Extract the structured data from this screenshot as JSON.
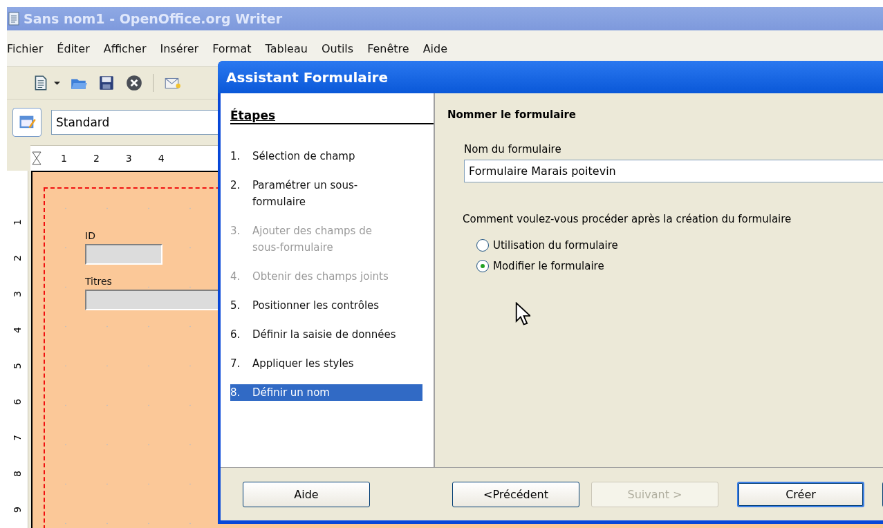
{
  "window": {
    "title": "Sans nom1 - OpenOffice.org Writer"
  },
  "menu": [
    "Fichier",
    "Éditer",
    "Afficher",
    "Insérer",
    "Format",
    "Tableau",
    "Outils",
    "Fenêtre",
    "Aide"
  ],
  "format_bar": {
    "paragraph_style": "Standard"
  },
  "ruler": {
    "horizontal": [
      "1",
      "2",
      "3",
      "4"
    ],
    "vertical": [
      "1",
      "2",
      "3",
      "4",
      "5",
      "6",
      "7",
      "8",
      "9"
    ]
  },
  "document": {
    "controls": [
      {
        "label": "ID",
        "kind": "short"
      },
      {
        "label": "Titres",
        "kind": "wide"
      }
    ]
  },
  "dialog": {
    "title": "Assistant Formulaire",
    "steps_heading": "Étapes",
    "steps": [
      {
        "number": "1.",
        "label": "Sélection de champ",
        "disabled": false,
        "selected": false
      },
      {
        "number": "2.",
        "label": "Paramétrer un sous-formulaire",
        "disabled": false,
        "selected": false
      },
      {
        "number": "3.",
        "label": "Ajouter des champs de sous-formulaire",
        "disabled": true,
        "selected": false
      },
      {
        "number": "4.",
        "label": "Obtenir des champs joints",
        "disabled": true,
        "selected": false
      },
      {
        "number": "5.",
        "label": "Positionner les contrôles",
        "disabled": false,
        "selected": false
      },
      {
        "number": "6.",
        "label": "Définir la saisie de données",
        "disabled": false,
        "selected": false
      },
      {
        "number": "7.",
        "label": "Appliquer les styles",
        "disabled": false,
        "selected": false
      },
      {
        "number": "8.",
        "label": "Définir un nom",
        "disabled": false,
        "selected": true
      }
    ],
    "section_title": "Nommer le formulaire",
    "name_label": "Nom du formulaire",
    "name_value": "Formulaire Marais poitevin",
    "question": "Comment voulez-vous procéder après la création du formulaire",
    "options": [
      {
        "label": "Utilisation du formulaire",
        "selected": false
      },
      {
        "label": "Modifier le formulaire",
        "selected": true
      }
    ],
    "buttons": [
      {
        "label": "Aide",
        "disabled": false,
        "default": false
      },
      {
        "label": "<Précédent",
        "disabled": false,
        "default": false
      },
      {
        "label": "Suivant >",
        "disabled": true,
        "default": false
      },
      {
        "label": "Créer",
        "disabled": false,
        "default": true
      }
    ]
  }
}
